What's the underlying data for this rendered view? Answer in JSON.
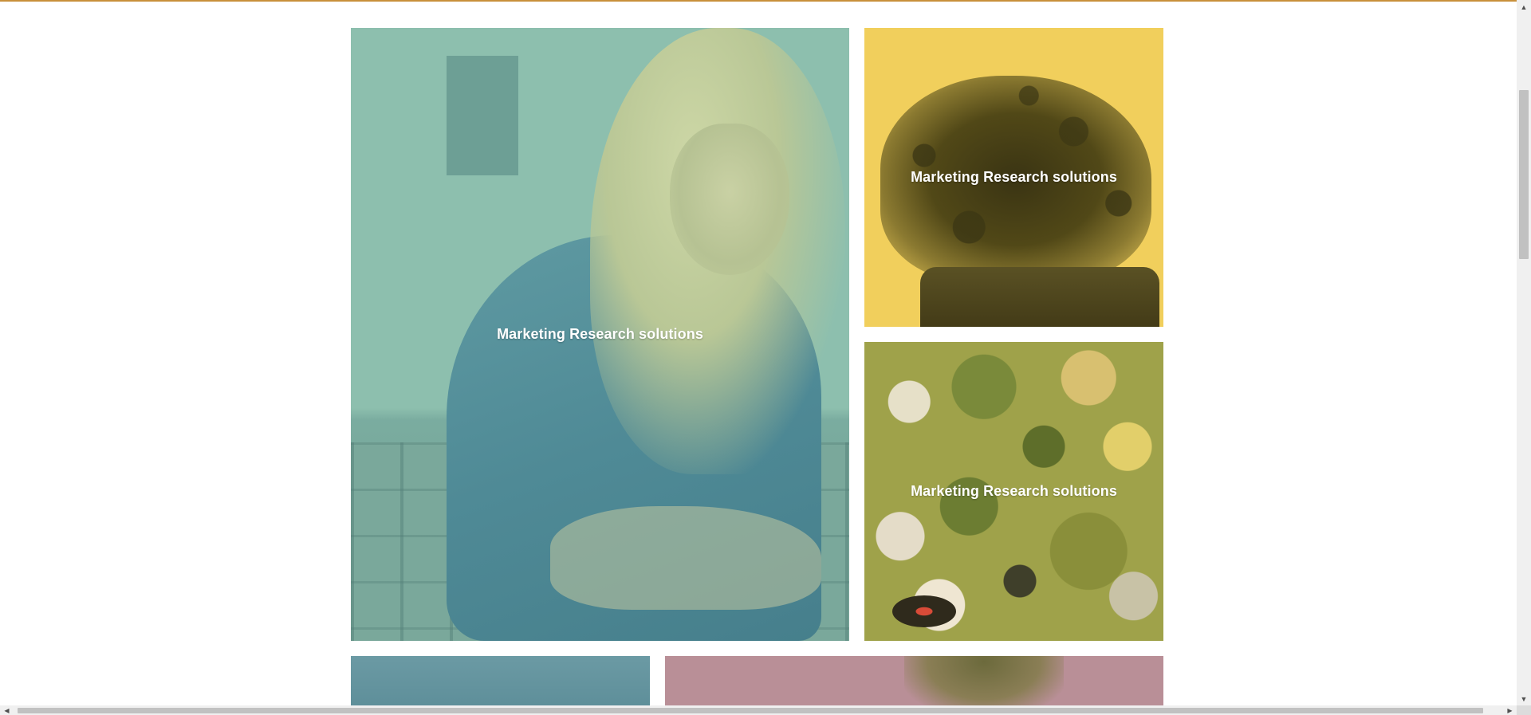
{
  "tiles": [
    {
      "caption": "Marketing Research solutions",
      "tint": "#8dbfae"
    },
    {
      "caption": "Marketing Research solutions",
      "tint": "#f1cf5c"
    },
    {
      "caption": "Marketing Research solutions",
      "tint": "#a8aa4f"
    }
  ],
  "colors": {
    "top_rule": "#c8903a",
    "bottom_left_tint": "#6b9aa4",
    "bottom_right_tint": "#b98f97"
  },
  "icons": {
    "scroll_up": "▲",
    "scroll_down": "▼",
    "scroll_left": "◀",
    "scroll_right": "▶"
  }
}
